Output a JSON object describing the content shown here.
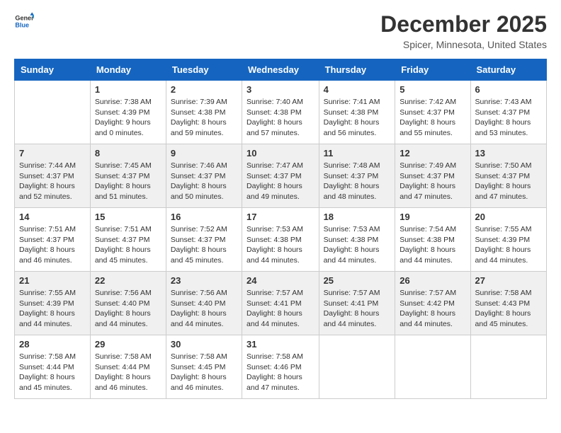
{
  "logo": {
    "line1": "General",
    "line2": "Blue"
  },
  "title": "December 2025",
  "location": "Spicer, Minnesota, United States",
  "days": [
    "Sunday",
    "Monday",
    "Tuesday",
    "Wednesday",
    "Thursday",
    "Friday",
    "Saturday"
  ],
  "weeks": [
    [
      {
        "date": "",
        "sunrise": "",
        "sunset": "",
        "daylight": ""
      },
      {
        "date": "1",
        "sunrise": "Sunrise: 7:38 AM",
        "sunset": "Sunset: 4:39 PM",
        "daylight": "Daylight: 9 hours and 0 minutes."
      },
      {
        "date": "2",
        "sunrise": "Sunrise: 7:39 AM",
        "sunset": "Sunset: 4:38 PM",
        "daylight": "Daylight: 8 hours and 59 minutes."
      },
      {
        "date": "3",
        "sunrise": "Sunrise: 7:40 AM",
        "sunset": "Sunset: 4:38 PM",
        "daylight": "Daylight: 8 hours and 57 minutes."
      },
      {
        "date": "4",
        "sunrise": "Sunrise: 7:41 AM",
        "sunset": "Sunset: 4:38 PM",
        "daylight": "Daylight: 8 hours and 56 minutes."
      },
      {
        "date": "5",
        "sunrise": "Sunrise: 7:42 AM",
        "sunset": "Sunset: 4:37 PM",
        "daylight": "Daylight: 8 hours and 55 minutes."
      },
      {
        "date": "6",
        "sunrise": "Sunrise: 7:43 AM",
        "sunset": "Sunset: 4:37 PM",
        "daylight": "Daylight: 8 hours and 53 minutes."
      }
    ],
    [
      {
        "date": "7",
        "sunrise": "Sunrise: 7:44 AM",
        "sunset": "Sunset: 4:37 PM",
        "daylight": "Daylight: 8 hours and 52 minutes."
      },
      {
        "date": "8",
        "sunrise": "Sunrise: 7:45 AM",
        "sunset": "Sunset: 4:37 PM",
        "daylight": "Daylight: 8 hours and 51 minutes."
      },
      {
        "date": "9",
        "sunrise": "Sunrise: 7:46 AM",
        "sunset": "Sunset: 4:37 PM",
        "daylight": "Daylight: 8 hours and 50 minutes."
      },
      {
        "date": "10",
        "sunrise": "Sunrise: 7:47 AM",
        "sunset": "Sunset: 4:37 PM",
        "daylight": "Daylight: 8 hours and 49 minutes."
      },
      {
        "date": "11",
        "sunrise": "Sunrise: 7:48 AM",
        "sunset": "Sunset: 4:37 PM",
        "daylight": "Daylight: 8 hours and 48 minutes."
      },
      {
        "date": "12",
        "sunrise": "Sunrise: 7:49 AM",
        "sunset": "Sunset: 4:37 PM",
        "daylight": "Daylight: 8 hours and 47 minutes."
      },
      {
        "date": "13",
        "sunrise": "Sunrise: 7:50 AM",
        "sunset": "Sunset: 4:37 PM",
        "daylight": "Daylight: 8 hours and 47 minutes."
      }
    ],
    [
      {
        "date": "14",
        "sunrise": "Sunrise: 7:51 AM",
        "sunset": "Sunset: 4:37 PM",
        "daylight": "Daylight: 8 hours and 46 minutes."
      },
      {
        "date": "15",
        "sunrise": "Sunrise: 7:51 AM",
        "sunset": "Sunset: 4:37 PM",
        "daylight": "Daylight: 8 hours and 45 minutes."
      },
      {
        "date": "16",
        "sunrise": "Sunrise: 7:52 AM",
        "sunset": "Sunset: 4:37 PM",
        "daylight": "Daylight: 8 hours and 45 minutes."
      },
      {
        "date": "17",
        "sunrise": "Sunrise: 7:53 AM",
        "sunset": "Sunset: 4:38 PM",
        "daylight": "Daylight: 8 hours and 44 minutes."
      },
      {
        "date": "18",
        "sunrise": "Sunrise: 7:53 AM",
        "sunset": "Sunset: 4:38 PM",
        "daylight": "Daylight: 8 hours and 44 minutes."
      },
      {
        "date": "19",
        "sunrise": "Sunrise: 7:54 AM",
        "sunset": "Sunset: 4:38 PM",
        "daylight": "Daylight: 8 hours and 44 minutes."
      },
      {
        "date": "20",
        "sunrise": "Sunrise: 7:55 AM",
        "sunset": "Sunset: 4:39 PM",
        "daylight": "Daylight: 8 hours and 44 minutes."
      }
    ],
    [
      {
        "date": "21",
        "sunrise": "Sunrise: 7:55 AM",
        "sunset": "Sunset: 4:39 PM",
        "daylight": "Daylight: 8 hours and 44 minutes."
      },
      {
        "date": "22",
        "sunrise": "Sunrise: 7:56 AM",
        "sunset": "Sunset: 4:40 PM",
        "daylight": "Daylight: 8 hours and 44 minutes."
      },
      {
        "date": "23",
        "sunrise": "Sunrise: 7:56 AM",
        "sunset": "Sunset: 4:40 PM",
        "daylight": "Daylight: 8 hours and 44 minutes."
      },
      {
        "date": "24",
        "sunrise": "Sunrise: 7:57 AM",
        "sunset": "Sunset: 4:41 PM",
        "daylight": "Daylight: 8 hours and 44 minutes."
      },
      {
        "date": "25",
        "sunrise": "Sunrise: 7:57 AM",
        "sunset": "Sunset: 4:41 PM",
        "daylight": "Daylight: 8 hours and 44 minutes."
      },
      {
        "date": "26",
        "sunrise": "Sunrise: 7:57 AM",
        "sunset": "Sunset: 4:42 PM",
        "daylight": "Daylight: 8 hours and 44 minutes."
      },
      {
        "date": "27",
        "sunrise": "Sunrise: 7:58 AM",
        "sunset": "Sunset: 4:43 PM",
        "daylight": "Daylight: 8 hours and 45 minutes."
      }
    ],
    [
      {
        "date": "28",
        "sunrise": "Sunrise: 7:58 AM",
        "sunset": "Sunset: 4:44 PM",
        "daylight": "Daylight: 8 hours and 45 minutes."
      },
      {
        "date": "29",
        "sunrise": "Sunrise: 7:58 AM",
        "sunset": "Sunset: 4:44 PM",
        "daylight": "Daylight: 8 hours and 46 minutes."
      },
      {
        "date": "30",
        "sunrise": "Sunrise: 7:58 AM",
        "sunset": "Sunset: 4:45 PM",
        "daylight": "Daylight: 8 hours and 46 minutes."
      },
      {
        "date": "31",
        "sunrise": "Sunrise: 7:58 AM",
        "sunset": "Sunset: 4:46 PM",
        "daylight": "Daylight: 8 hours and 47 minutes."
      },
      {
        "date": "",
        "sunrise": "",
        "sunset": "",
        "daylight": ""
      },
      {
        "date": "",
        "sunrise": "",
        "sunset": "",
        "daylight": ""
      },
      {
        "date": "",
        "sunrise": "",
        "sunset": "",
        "daylight": ""
      }
    ]
  ]
}
